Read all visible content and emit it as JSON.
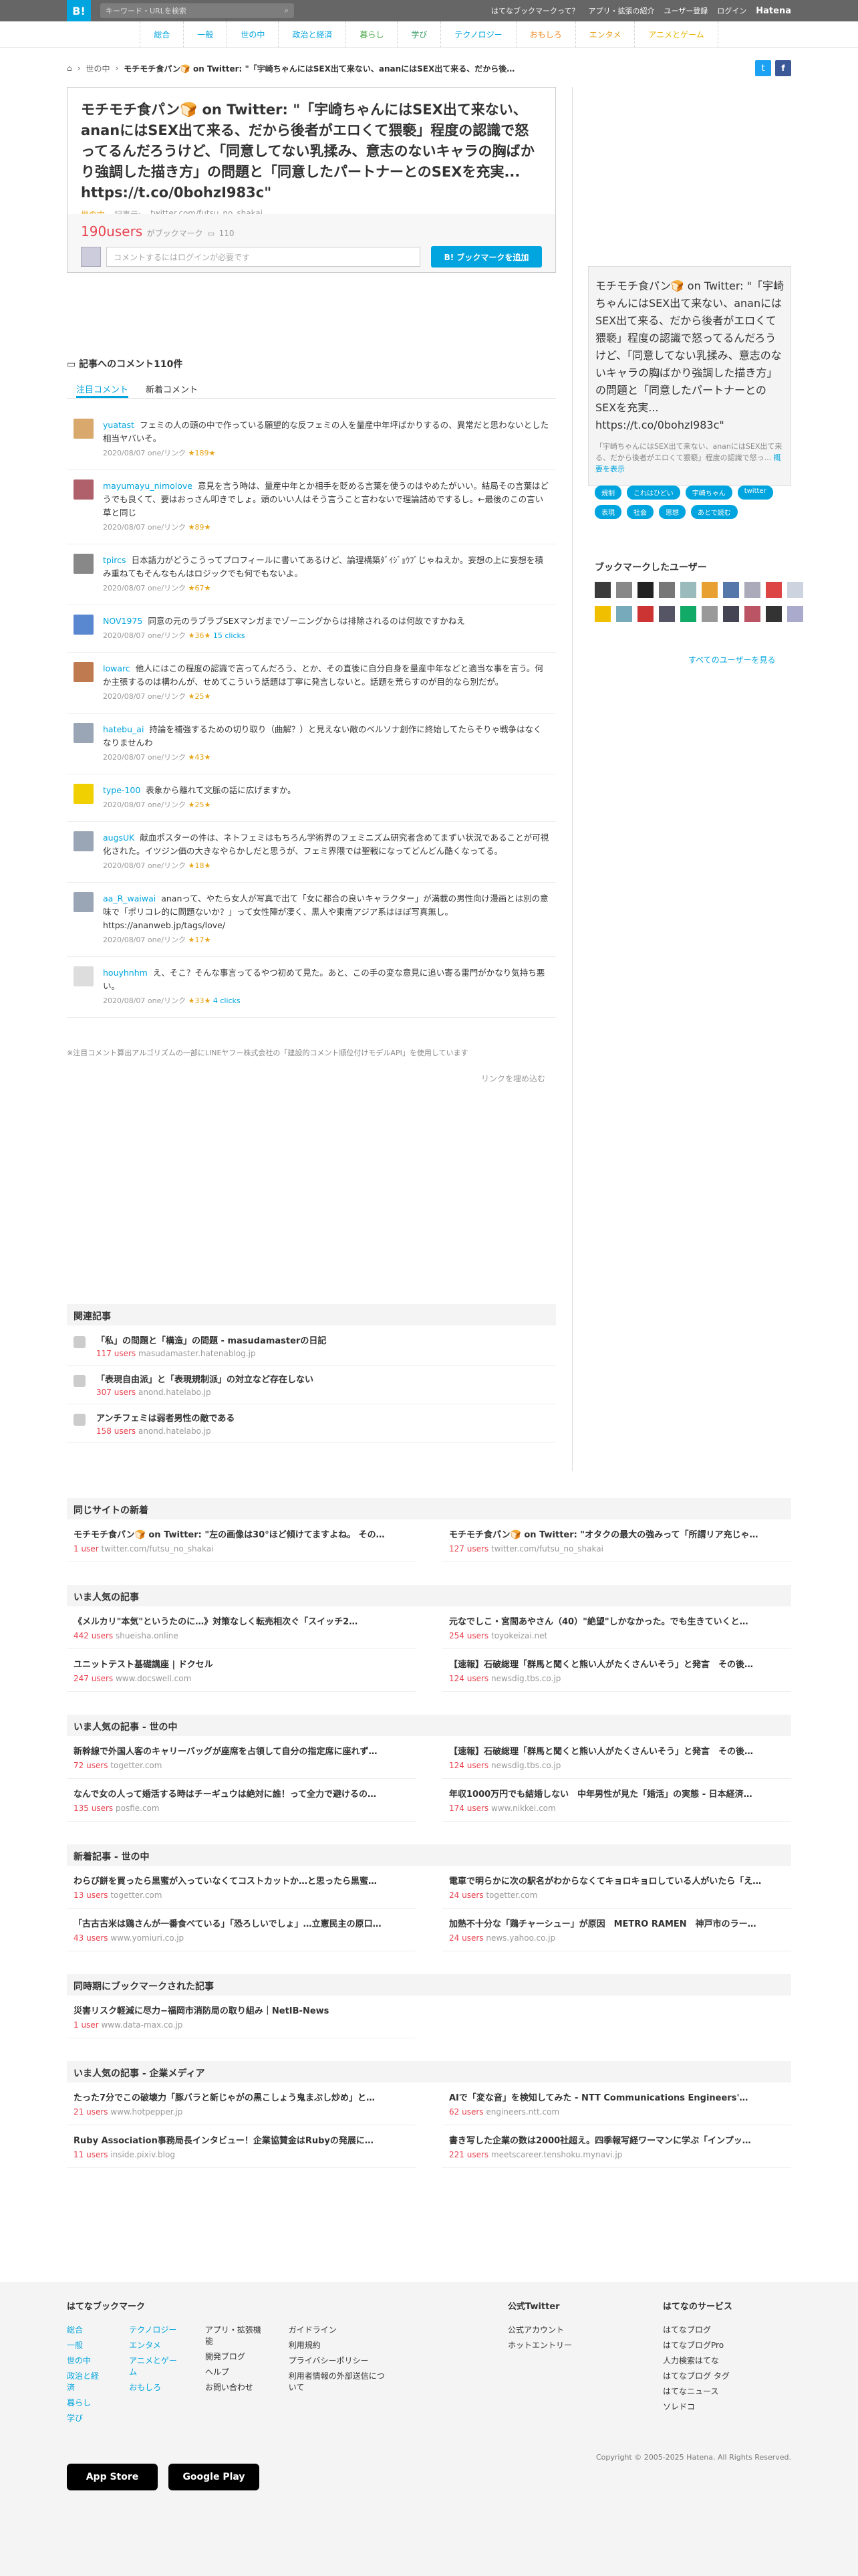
{
  "topbar": {
    "logo": "B!",
    "search_placeholder": "キーワード・URLを検索",
    "links": [
      "はてなブックマークって？",
      "アプリ・拡張の紹介",
      "ユーザー登録",
      "ログイン"
    ],
    "brand": "Hatena"
  },
  "nav": [
    {
      "label": "総合",
      "cls": ""
    },
    {
      "label": "一般",
      "cls": ""
    },
    {
      "label": "世の中",
      "cls": ""
    },
    {
      "label": "政治と経済",
      "cls": ""
    },
    {
      "label": "暮らし",
      "cls": "c-life"
    },
    {
      "label": "学び",
      "cls": "c-learn"
    },
    {
      "label": "テクノロジー",
      "cls": "c-tech"
    },
    {
      "label": "おもしろ",
      "cls": "c-fun"
    },
    {
      "label": "エンタメ",
      "cls": "c-ent"
    },
    {
      "label": "アニメとゲーム",
      "cls": "c-game"
    }
  ],
  "breadcrumb": {
    "category": "世の中",
    "title": "モチモチ食パン🍞 on Twitter: \"「宇崎ちゃんにはSEX出て来ない、ananにはSEX出て来る、だから後…"
  },
  "entry": {
    "title": "モチモチ食パン🍞 on Twitter: \"「宇崎ちゃんにはSEX出て来ない、ananにはSEX出て来る、だから後者がエロくて猥褻」程度の認識で怒ってるんだろうけど、「同意してない乳揉み、意志のないキャラの胸ばかり強調した描き方」の問題と「同意したパートナーとのSEXを充実... https://t.co/0bohzI983c\"",
    "category": "世の中",
    "edit": "記事元:",
    "source": "twitter.com/futsu_no_shakai"
  },
  "bookmark": {
    "users": "190users",
    "users_suffix": "がブックマーク",
    "comments_count": "110",
    "comment_placeholder": "コメントするにはログインが必要です",
    "add_button": "B! ブックマークを追加"
  },
  "side": {
    "title": "モチモチ食パン🍞 on Twitter: \"「宇崎ちゃんにはSEX出て来ない、ananにはSEX出て来る、だから後者がエロくて猥褻」程度の認識で怒ってるんだろうけど、「同意してない乳揉み、意志のないキャラの胸ばかり強調した描き方」の問題と「同意したパートナーとのSEXを充実... https://t.co/0bohzI983c\"",
    "desc": "「宇崎ちゃんにはSEX出て来ない、ananにはSEX出て来る、だから後者がエロくて猥褻」程度の認識で怒っ...",
    "more": "概要を表示"
  },
  "tags": [
    "規制",
    "これはひどい",
    "宇崎ちゃん",
    "twitter",
    "表現",
    "社会",
    "思想",
    "あとで読む"
  ],
  "bookmark_users": {
    "heading": "ブックマークしたユーザー",
    "more": "すべてのユーザーを見る"
  },
  "comments_section": {
    "heading": "記事へのコメント110件",
    "tab_popular": "注目コメント",
    "tab_new": "新着コメント"
  },
  "comments": [
    {
      "user": "yuatast",
      "text": "フェミの人の頭の中で作っている願望的な反フェミの人を量産中年坪ばかりするの、異常だと思わないとした相当ヤバいそ。",
      "date": "2020/08/07",
      "link": "one/リンク",
      "stars": "★189★",
      "clicks": ""
    },
    {
      "user": "mayumayu_nimolove",
      "text": "意見を言う時は、量産中年とか相手を貶める言葉を使うのはやめたがいい。結局その言葉はどうでも良くて、要はおっさん叩きでしょ。頭のいい人はそう言うこと言わないで理論詰めでするし。←最後のこの言い草と同じ",
      "date": "2020/08/07",
      "link": "one/リンク",
      "stars": "★89★",
      "clicks": ""
    },
    {
      "user": "tpircs",
      "text": "日本語力がどうこうってプロフィールに書いてあるけど、論理構築ﾀﾞｲｼﾞｮｳﾌﾞじゃねえか。妄想の上に妄想を積み重ねてもそんなもんはロジックでも何でもないよ。",
      "date": "2020/08/07",
      "link": "one/リンク",
      "stars": "★67★",
      "clicks": ""
    },
    {
      "user": "NOV1975",
      "text": "同意の元のラブラブSEXマンガまでゾーニングからは排除されるのは何故ですかねえ",
      "date": "2020/08/07",
      "link": "one/リンク",
      "stars": "★36★",
      "clicks": "15 clicks"
    },
    {
      "user": "lowarc",
      "text": "他人にはこの程度の認識で言ってんだろう、とか、その直後に自分自身を量産中年などと適当な事を言う。何か主張するのは構わんが、せめてこういう話題は丁寧に発言しないと。話題を荒らすのが目的なら別だが。",
      "date": "2020/08/07",
      "link": "one/リンク",
      "stars": "★25★",
      "clicks": ""
    },
    {
      "user": "hatebu_ai",
      "text": "持論を補強するための切り取り（曲解？）と見えない敵のベルソナ創作に終始してたらそりゃ戦争はなくなりませんわ",
      "date": "2020/08/07",
      "link": "one/リンク",
      "stars": "★43★",
      "clicks": ""
    },
    {
      "user": "type-100",
      "text": "表象から離れて文脈の話に広げますか。",
      "date": "2020/08/07",
      "link": "one/リンク",
      "stars": "★25★",
      "clicks": ""
    },
    {
      "user": "augsUK",
      "text": "献血ポスターの件は、ネトフェミはもちろん学術界のフェミニズム研究者含めてまずい状況であることが可視化された。イツジン価の大きなやらかしだと思うが、フェミ界隈では聖戦になってどんどん酷くなってる。",
      "date": "2020/08/07",
      "link": "one/リンク",
      "stars": "★18★",
      "clicks": ""
    },
    {
      "user": "aa_R_waiwai",
      "text": "ananって、やたら女人が写真で出て「女に都合の良いキャラクター」が満載の男性向け漫画とは別の意味で「ポリコレ的に問題ないか？」って女性陣が凄く、黒人や東南アジア系はほぼ写真無し。https://ananweb.jp/tags/love/",
      "date": "2020/08/07",
      "link": "one/リンク",
      "stars": "★17★",
      "clicks": ""
    },
    {
      "user": "houyhnhm",
      "text": "え、そこ？そんな事言ってるやつ初めて見た。あと、この手の変な意見に追い寄る雷門がかなり気持ち悪い。",
      "date": "2020/08/07",
      "link": "one/リンク",
      "stars": "★33★",
      "clicks": "4 clicks"
    }
  ],
  "comments_note": "※注目コメント算出アルゴリズムの一部にLINEヤフー株式会社の「建設的コメント順位付けモデルAPI」を使用しています",
  "more_comments": "リンクを埋め込む",
  "related": {
    "heading": "関連記事",
    "items": [
      {
        "title": "「私」の問題と「構造」の問題 - masudamasterの日記",
        "users": "117 users",
        "src": "masudamaster.hatenablog.jp"
      },
      {
        "title": "「表現自由派」と「表現規制派」の対立など存在しない",
        "users": "307 users",
        "src": "anond.hatelabo.jp"
      },
      {
        "title": "アンチフェミは弱者男性の敵である",
        "users": "158 users",
        "src": "anond.hatelabo.jp"
      }
    ]
  },
  "blocks": [
    {
      "heading": "同じサイトの新着",
      "items": [
        {
          "title": "モチモチ食パン🍞 on Twitter: \"左の画像は30°ほど傾けてますよね。 その…",
          "users": "1 user",
          "src": "twitter.com/futsu_no_shakai"
        },
        {
          "title": "モチモチ食パン🍞 on Twitter: \"オタクの最大の強みって「所謂リア充じゃ…",
          "users": "127 users",
          "src": "twitter.com/futsu_no_shakai"
        }
      ]
    },
    {
      "heading": "いま人気の記事",
      "items": [
        {
          "title": "《メルカリ\"本気\"というたのに…》対策なしく転売相次ぐ「スイッチ2…",
          "users": "442 users",
          "src": "shueisha.online"
        },
        {
          "title": "元なでしこ・宮間あやさん（40）\"絶望\"しかなかった。でも生きていくと…",
          "users": "254 users",
          "src": "toyokeizai.net"
        },
        {
          "title": "ユニットテスト基礎講座 | ドクセル",
          "users": "247 users",
          "src": "www.docswell.com"
        },
        {
          "title": "【速報】石破総理「群馬と聞くと熊い人がたくさんいそう」と発言　その後…",
          "users": "124 users",
          "src": "newsdig.tbs.co.jp"
        }
      ]
    },
    {
      "heading": "いま人気の記事 - 世の中",
      "items": [
        {
          "title": "新幹線で外国人客のキャリーバッグが座席を占領して自分の指定席に座れず…",
          "users": "72 users",
          "src": "togetter.com"
        },
        {
          "title": "【速報】石破総理「群馬と聞くと熊い人がたくさんいそう」と発言　その後…",
          "users": "124 users",
          "src": "newsdig.tbs.co.jp"
        },
        {
          "title": "なんで女の人って婚活する時はチーギュウは絶対に誰！って全力で避けるの…",
          "users": "135 users",
          "src": "posfie.com"
        },
        {
          "title": "年収1000万円でも結婚しない　中年男性が見た「婚活」の実態 - 日本経済…",
          "users": "174 users",
          "src": "www.nikkei.com"
        }
      ]
    },
    {
      "heading": "新着記事 - 世の中",
      "items": [
        {
          "title": "わらび餅を買ったら黒蜜が入っていなくてコストカットか…と思ったら黒蜜…",
          "users": "13 users",
          "src": "togetter.com"
        },
        {
          "title": "電車で明らかに次の駅名がわからなくてキョロキョロしている人がいたら「え…",
          "users": "24 users",
          "src": "togetter.com"
        },
        {
          "title": "「古古古米は鶏さんが一番食べている」「恐ろしいでしょ」…立憲民主の原口…",
          "users": "43 users",
          "src": "www.yomiuri.co.jp"
        },
        {
          "title": "加熱不十分な「鶏チャーシュー」が原因　METRO RAMEN　神戸市のラー…",
          "users": "24 users",
          "src": "news.yahoo.co.jp"
        }
      ]
    },
    {
      "heading": "同時期にブックマークされた記事",
      "items": [
        {
          "title": "災害リスク軽減に尽力−福岡市消防局の取り組み｜NetIB-News",
          "users": "1 user",
          "src": "www.data-max.co.jp"
        }
      ]
    },
    {
      "heading": "いま人気の記事 - 企業メディア",
      "items": [
        {
          "title": "たった7分でこの破壊力「豚バラと新じゃがの黒こしょう鬼まぶし炒め」と…",
          "users": "21 users",
          "src": "www.hotpepper.jp"
        },
        {
          "title": "AIで「変な音」を検知してみた - NTT Communications Engineers'…",
          "users": "62 users",
          "src": "engineers.ntt.com"
        },
        {
          "title": "Ruby Association事務局長インタビュー！企業協賛金はRubyの発展に…",
          "users": "11 users",
          "src": "inside.pixiv.blog"
        },
        {
          "title": "書き写した企業の数は2000社超え。四季報写経ワーマンに学ぶ「インプッ…",
          "users": "221 users",
          "src": "meetscareer.tenshoku.mynavi.jp"
        }
      ]
    }
  ],
  "footer": {
    "heading": "はてなブックマーク",
    "col1": [
      "総合",
      "一般",
      "世の中",
      "政治と経済",
      "暮らし",
      "学び"
    ],
    "col2": [
      "テクノロジー",
      "エンタメ",
      "アニメとゲーム",
      "おもしろ"
    ],
    "col3": [
      "アプリ・拡張機能",
      "開発ブログ",
      "ヘルプ",
      "お問い合わせ"
    ],
    "col4": [
      "ガイドライン",
      "利用規約",
      "プライバシーポリシー",
      "利用者情報の外部送信について"
    ],
    "twitter_heading": "公式Twitter",
    "twitter": [
      "公式アカウント",
      "ホットエントリー"
    ],
    "services_heading": "はてなのサービス",
    "services": [
      "はてなブログ",
      "はてなブログPro",
      "人力検索はてな",
      "はてなブログ タグ",
      "はてなニュース",
      "ソレドコ"
    ],
    "appstore": "App Store",
    "googleplay": "Google Play",
    "copyright": "Copyright © 2005-2025 Hatena. All Rights Reserved."
  }
}
